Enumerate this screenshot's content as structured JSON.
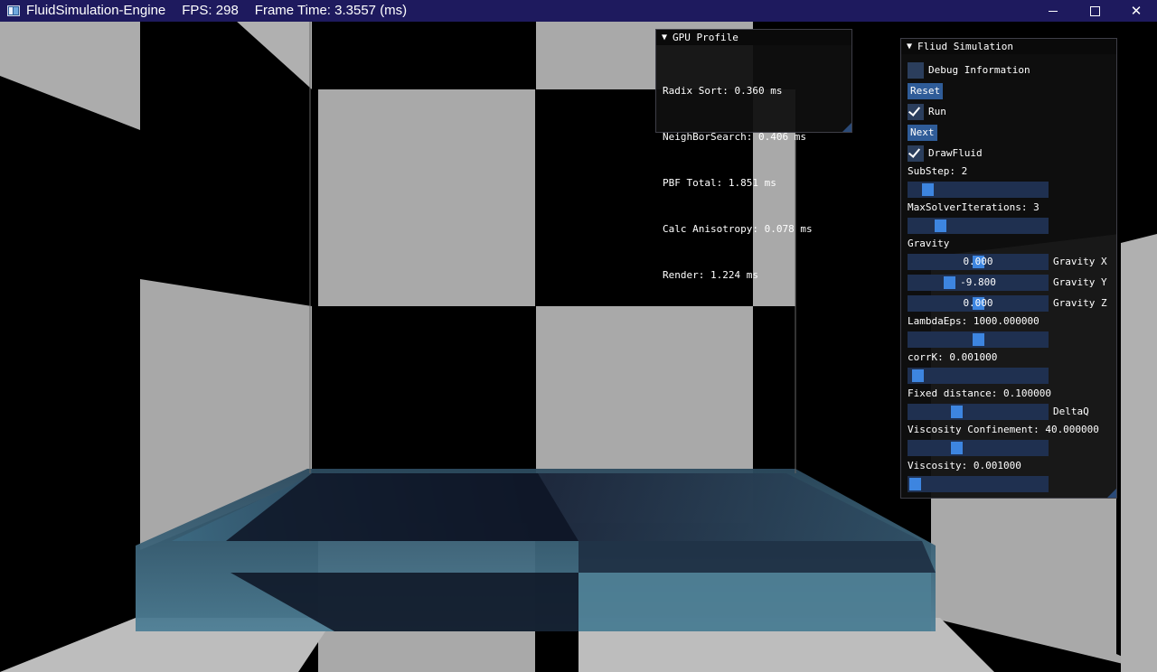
{
  "titlebar": {
    "app_name": "FluidSimulation-Engine",
    "fps": "FPS: 298",
    "frame_time": "Frame Time: 3.3557 (ms)"
  },
  "window_controls": {
    "minimize": "minimize-icon",
    "maximize": "maximize-icon",
    "close": "✕"
  },
  "gpu_profile": {
    "title": "GPU Profile",
    "lines": [
      "Radix Sort: 0.360 ms",
      "NeighBorSearch: 0.406 ms",
      "PBF Total: 1.851 ms",
      "Calc Anisotropy: 0.078 ms",
      "Render: 1.224 ms"
    ]
  },
  "fluid_panel": {
    "title": "Fliud Simulation",
    "debug_info": {
      "label": "Debug Information",
      "checked": false
    },
    "reset": "Reset",
    "run": {
      "label": "Run",
      "checked": true
    },
    "next": "Next",
    "draw_fluid": {
      "label": "DrawFluid",
      "checked": true
    },
    "substep": {
      "label": "SubStep: 2",
      "fraction": 0.1
    },
    "max_solver": {
      "label": "MaxSolverIterations: 3",
      "fraction": 0.2
    },
    "gravity_label": "Gravity",
    "gravity_x": {
      "value": "0.000",
      "label": "Gravity X",
      "fraction": 0.5
    },
    "gravity_y": {
      "value": "-9.800",
      "label": "Gravity Y",
      "fraction": 0.27
    },
    "gravity_z": {
      "value": "0.000",
      "label": "Gravity Z",
      "fraction": 0.5
    },
    "lambda_eps": {
      "label": "LambdaEps: 1000.000000",
      "fraction": 0.5
    },
    "corrk": {
      "label": "corrK: 0.001000",
      "fraction": 0.02
    },
    "fixed_distance": {
      "label": "Fixed distance: 0.100000",
      "fraction": 0.33,
      "side": "DeltaQ"
    },
    "viscosity_confinement": {
      "label": "Viscosity Confinement: 40.000000",
      "fraction": 0.33
    },
    "viscosity": {
      "label": "Viscosity: 0.001000",
      "fraction": 0.0
    }
  },
  "colors": {
    "titlebar": "#1e1a5e",
    "panel_bg": "#0f0f0f",
    "widget_bg": "#1f3050",
    "accent": "#3d85e0",
    "button": "#2f5c98"
  }
}
